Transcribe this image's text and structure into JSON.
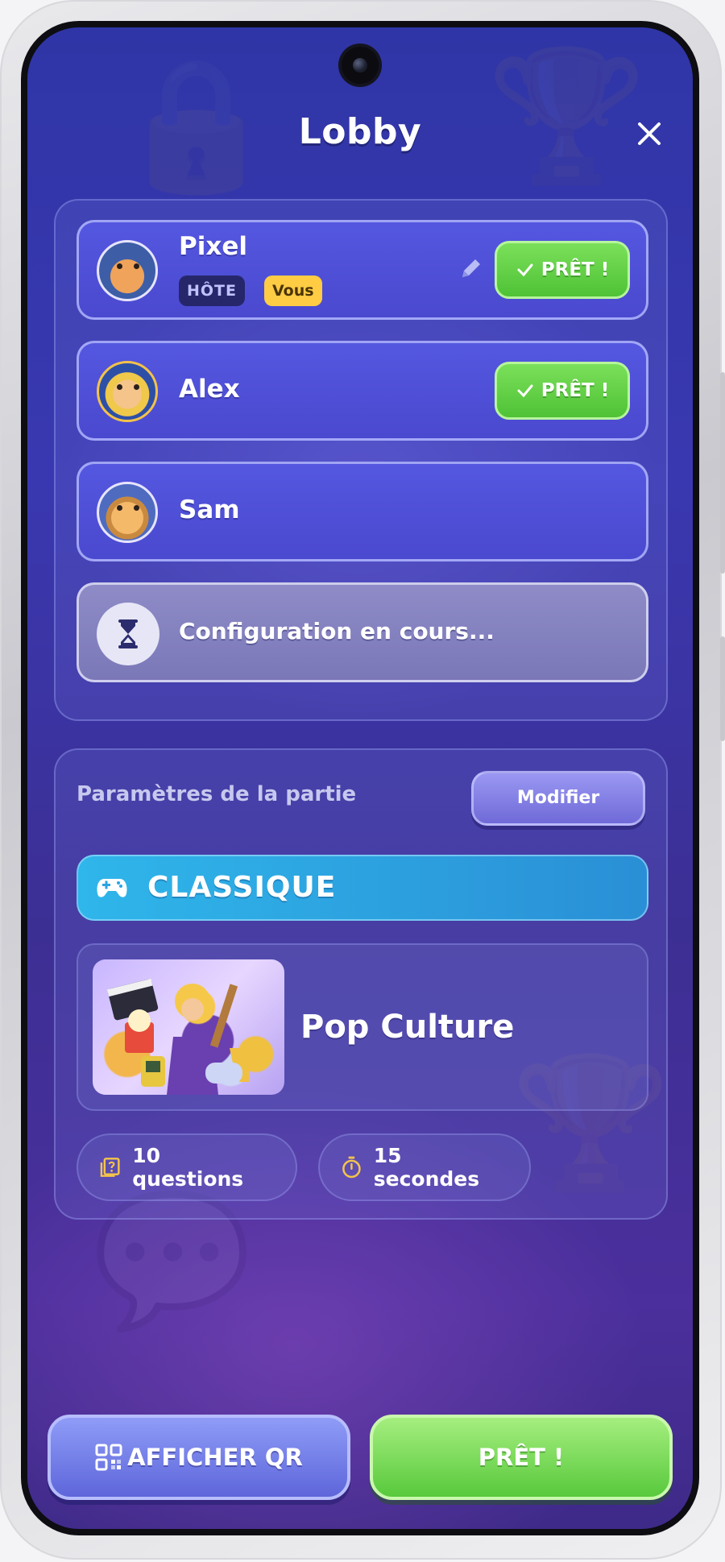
{
  "header": {
    "title": "Lobby"
  },
  "players": [
    {
      "name": "Pixel",
      "host_badge": "HÔTE",
      "you_badge": "Vous",
      "status": "PRÊT !"
    },
    {
      "name": "Alex",
      "status": "PRÊT !"
    },
    {
      "name": "Sam"
    }
  ],
  "pending_slot": {
    "label": "Configuration en cours..."
  },
  "settings": {
    "label": "Paramètres de la partie",
    "modify_label": "Modifier",
    "mode": "CLASSIQUE",
    "theme": "Pop Culture",
    "questions": "10 questions",
    "timer": "15 secondes"
  },
  "actions": {
    "qr_label": "AFFICHER QR",
    "ready_label": "PRÊT !"
  },
  "colors": {
    "ready_green": "#5ecf40",
    "card_blue": "#4f50d8",
    "mode_blue": "#2aa5e3",
    "you_badge": "#ffcc44"
  }
}
